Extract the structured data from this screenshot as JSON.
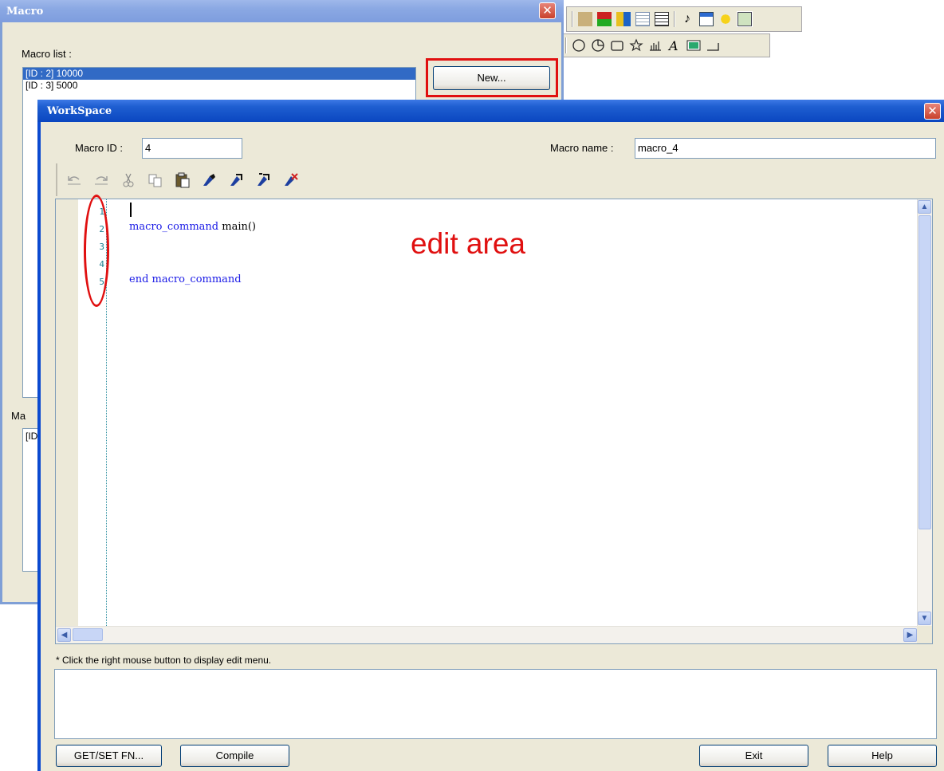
{
  "macro_window": {
    "title": "Macro",
    "macro_list_label": "Macro list :",
    "macro_list_items": [
      "[ID : 2] 10000",
      "[ID : 3] 5000"
    ],
    "new_button": "New...",
    "lower_label": "Ma",
    "lower_list_item": "[ID"
  },
  "workspace": {
    "title": "WorkSpace",
    "macro_id_label": "Macro ID :",
    "macro_id_value": "4",
    "macro_name_label": "Macro name :",
    "macro_name_value": "macro_4",
    "line_numbers": [
      "1",
      "2",
      "3",
      "4",
      "5"
    ],
    "code_line_2_keyword": "macro_command",
    "code_line_2_rest": " main()",
    "code_line_5": "end macro_command",
    "annotation": "edit area",
    "hint": "* Click the right mouse button to display edit menu.",
    "buttons": {
      "getset": "GET/SET FN...",
      "compile": "Compile",
      "exit": "Exit",
      "help": "Help"
    }
  },
  "icons": {
    "close": "close-icon",
    "undo": "undo-icon",
    "redo": "redo-icon",
    "cut": "cut-icon",
    "copy": "copy-icon",
    "paste": "paste-icon",
    "bookmark": "bookmark-icon"
  },
  "colors": {
    "annotation_red": "#e01010",
    "selection_blue": "#316ac5",
    "xp_title_blue": "#0a46c0",
    "keyword_blue": "#1a1ae6"
  }
}
